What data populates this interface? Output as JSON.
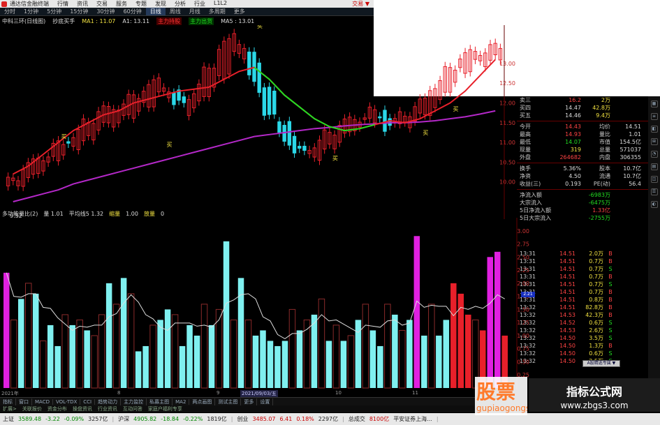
{
  "titlebar": {
    "app_title": "通达信金融终端",
    "menu": [
      "行情",
      "资讯",
      "交易",
      "服务",
      "专题",
      "发现",
      "分析",
      "行业",
      "L1L2"
    ],
    "login": "交易 ▼"
  },
  "periods": [
    "分时",
    "1分钟",
    "5分钟",
    "15分钟",
    "30分钟",
    "60分钟",
    "日线",
    "周线",
    "月线",
    "多周期",
    "更多"
  ],
  "period_selected": "日线",
  "infoline": {
    "name": "中科三环(日线图)",
    "indicator": "抄底买手",
    "ma5": "MA1 : 11.07",
    "a1": "A1: 13.11",
    "sig_red": "主力持股",
    "sig_green": "主力出货",
    "ma_last": "MA5 : 13.01"
  },
  "kline_axis": {
    "labels": [
      "13.00",
      "12.50",
      "12.00",
      "11.50",
      "11.00",
      "10.50",
      "10.00"
    ],
    "low_label": "9.32",
    "buy_label": "买"
  },
  "volinfo": {
    "title": "多功能量比(2)",
    "v1": "量 1.01",
    "v2": "平均线5 1.32",
    "v3": "缩量",
    "v4": "1.00",
    "v5": "放量",
    "v6": "0"
  },
  "vol_axis": {
    "labels": [
      "3.00",
      "2.75",
      "2.50",
      "2.25",
      "2.00",
      "1.75",
      "1.50",
      "1.25",
      "1.00",
      "0.75",
      "0.50",
      "0.25"
    ],
    "current": "2.21"
  },
  "dates": [
    "2021年",
    "8",
    "9",
    "2021/09/03/五",
    "10",
    "11"
  ],
  "tabs": [
    "指标",
    "窗口",
    "MACD",
    "VOL-TDX",
    "CCI",
    "趋势动力",
    "主力监控",
    "私募主图",
    "MA2",
    "两点画图",
    "测试主图",
    "更多",
    "设置"
  ],
  "subtabs": [
    "扩展>",
    "关联报价",
    "资金分布",
    "操盘资讯",
    "行业资讯",
    "互动问答",
    "家庭户福利专享"
  ],
  "indexbar": [
    {
      "name": "上证",
      "val": "3589.48",
      "chg": "-3.22",
      "pct": "-0.09%",
      "amt": "3257亿"
    },
    {
      "name": "沪深",
      "val": "4905.82",
      "chg": "-18.84",
      "pct": "-0.22%",
      "amt": "1819亿"
    },
    {
      "name": "创业",
      "val": "3485.07",
      "chg": "6.41",
      "pct": "0.18%",
      "amt": "2297亿"
    },
    {
      "name": "总成交",
      "val": "8100亿",
      "chg": "",
      "pct": "",
      "amt": "平安证券上海..."
    }
  ],
  "quote": {
    "rows": [
      {
        "k": "卖三",
        "p": "16.2",
        "v": "2万",
        "pc": "red"
      },
      {
        "k": "买四",
        "p": "14.47",
        "v": "42.8万",
        "pc": "wht"
      },
      {
        "k": "买五",
        "p": "14.46",
        "v": "9.4万",
        "pc": "wht"
      },
      {
        "k": "今开",
        "p": "14.43",
        "v": "均价",
        "v2": "14.51",
        "pc": "red"
      },
      {
        "k": "最高",
        "p": "14.93",
        "v": "量比",
        "v2": "1.01",
        "pc": "red"
      },
      {
        "k": "最低",
        "p": "14.07",
        "v": "市值",
        "v2": "154.5亿",
        "pc": "grn"
      },
      {
        "k": "现量",
        "p": "319",
        "v": "总量",
        "v2": "571037",
        "pc": "yel"
      },
      {
        "k": "外盘",
        "p": "264682",
        "v": "内盘",
        "v2": "306355",
        "pc": "red"
      },
      {
        "k": "换手",
        "p": "5.36%",
        "v": "股本",
        "v2": "10.7亿",
        "pc": "wht"
      },
      {
        "k": "净资",
        "p": "4.50",
        "v": "流通",
        "v2": "10.7亿",
        "pc": "wht"
      },
      {
        "k": "收益(三)",
        "p": "0.193",
        "v": "PE(动)",
        "v2": "56.4",
        "pc": "wht"
      }
    ],
    "flows": [
      {
        "k": "净流入额",
        "v": "-6983万",
        "pc": "grn"
      },
      {
        "k": "大宗流入",
        "v": "-6475万",
        "pc": "grn"
      },
      {
        "k": "5日净流入额",
        "v": "1.33亿",
        "pc": "red"
      },
      {
        "k": "5日大宗流入",
        "v": "-2755万",
        "pc": "grn"
      }
    ]
  },
  "ticks": [
    {
      "t": "13:31",
      "p": "14.51",
      "v": "2.0万",
      "bs": "B"
    },
    {
      "t": "13:31",
      "p": "14.51",
      "v": "0.7万",
      "bs": "B"
    },
    {
      "t": "13:31",
      "p": "14.51",
      "v": "0.7万",
      "bs": "S"
    },
    {
      "t": "13:31",
      "p": "14.51",
      "v": "0.7万",
      "bs": "B"
    },
    {
      "t": "13:31",
      "p": "14.51",
      "v": "0.7万",
      "bs": "S"
    },
    {
      "t": "13:31",
      "p": "14.51",
      "v": "0.7万",
      "bs": "B"
    },
    {
      "t": "13:31",
      "p": "14.51",
      "v": "0.8万",
      "bs": "B"
    },
    {
      "t": "13:32",
      "p": "14.51",
      "v": "82.8万",
      "bs": "B"
    },
    {
      "t": "13:32",
      "p": "14.53",
      "v": "42.3万",
      "bs": "B"
    },
    {
      "t": "13:32",
      "p": "14.52",
      "v": "0.6万",
      "bs": "S"
    },
    {
      "t": "13:32",
      "p": "14.53",
      "v": "2.6万",
      "bs": "S"
    },
    {
      "t": "13:32",
      "p": "14.50",
      "v": "3.5万",
      "bs": "S"
    },
    {
      "t": "13:32",
      "p": "14.50",
      "v": "1.3万",
      "bs": "B"
    },
    {
      "t": "13:32",
      "p": "14.50",
      "v": "0.6万",
      "bs": "S"
    },
    {
      "t": "13:32",
      "p": "14.50",
      "v": "2.5万",
      "bs": "S"
    }
  ],
  "popup": "A股精选专属 ▼",
  "watermark": {
    "big": "股票",
    "small": "gupiaogongshi",
    "site_title": "指标公式网",
    "site_url": "www.zbgs3.com"
  },
  "colors": {
    "up": "#e8202a",
    "down": "#2bd8e8",
    "ma_red": "#e8202a",
    "ma_green": "#22dd22",
    "ma_purple": "#b428c8",
    "vol_cyan": "#7ff0f0",
    "vol_brown": "#5a1212",
    "vol_magenta": "#e020e0"
  },
  "chart_data": {
    "type": "line",
    "kline": {
      "ma_red": [
        10.2,
        10.4,
        10.7,
        11.0,
        11.3,
        11.5,
        11.7,
        11.8,
        12.0,
        12.1,
        12.2,
        12.3,
        12.35,
        12.4,
        12.6,
        12.8,
        12.9,
        12.6,
        12.2,
        11.9,
        11.6,
        11.4,
        11.3,
        11.35,
        11.45,
        11.55,
        11.5,
        11.6,
        11.8,
        12.0,
        12.3,
        12.7,
        13.1
      ],
      "ma_purple": [
        9.5,
        9.6,
        9.7,
        9.8,
        9.95,
        10.05,
        10.15,
        10.25,
        10.35,
        10.45,
        10.55,
        10.65,
        10.75,
        10.85,
        10.95,
        11.05,
        11.15,
        11.2,
        11.25,
        11.3,
        11.35,
        11.38,
        11.42,
        11.45,
        11.47,
        11.5,
        11.5,
        11.52,
        11.55,
        11.6,
        11.65,
        11.72,
        11.8
      ],
      "candles": [
        [
          9.9,
          10.0
        ],
        [
          10.0,
          10.4
        ],
        [
          10.3,
          10.6
        ],
        [
          10.6,
          10.9
        ],
        [
          10.9,
          11.1
        ],
        [
          11.0,
          11.5
        ],
        [
          11.4,
          11.8
        ],
        [
          11.5,
          11.9
        ],
        [
          11.7,
          12.1
        ],
        [
          11.9,
          12.4
        ],
        [
          12.2,
          12.6
        ],
        [
          12.3,
          11.9
        ],
        [
          11.8,
          12.2
        ],
        [
          12.2,
          12.8
        ],
        [
          12.6,
          13.4
        ],
        [
          13.2,
          13.8
        ],
        [
          13.3,
          12.6
        ],
        [
          12.5,
          11.8
        ],
        [
          11.6,
          11.2
        ],
        [
          11.1,
          10.7
        ],
        [
          10.6,
          10.9
        ],
        [
          10.8,
          11.2
        ],
        [
          11.1,
          11.5
        ],
        [
          11.4,
          11.6
        ],
        [
          11.6,
          11.8
        ],
        [
          11.7,
          11.4
        ],
        [
          11.4,
          11.7
        ],
        [
          11.6,
          11.9
        ],
        [
          11.8,
          12.4
        ],
        [
          12.3,
          12.8
        ],
        [
          12.8,
          13.2
        ],
        [
          13.0,
          13.3
        ],
        [
          13.1,
          13.4
        ]
      ]
    },
    "volume": {
      "ylim": [
        0,
        3.25
      ],
      "bars": [
        2.2,
        1.3,
        1.7,
        2.0,
        1.8,
        0.9,
        1.2,
        0.8,
        1.4,
        1.2,
        1.3,
        1.1,
        1.0,
        1.4,
        2.0,
        1.6,
        2.1,
        1.8,
        0.7,
        0.8,
        1.2,
        1.3,
        1.5,
        1.4,
        0.8,
        1.2,
        1.0,
        1.6,
        1.2,
        1.5,
        2.8,
        1.3,
        2.1,
        1.3,
        1.0,
        1.1,
        0.9,
        0.8,
        0.9,
        1.5,
        1.1,
        1.3,
        1.4,
        1.7,
        0.9,
        1.2,
        0.9,
        1.0,
        1.3,
        1.6,
        1.1,
        0.8,
        1.6,
        1.4,
        1.1,
        1.3,
        2.9,
        1.0,
        1.6,
        1.0,
        1.3,
        2.0,
        1.8,
        1.4,
        1.3,
        1.1,
        2.5,
        2.6,
        1.0
      ],
      "kinds": [
        "m",
        "b",
        "c",
        "b",
        "c",
        "b",
        "c",
        "c",
        "b",
        "c",
        "b",
        "c",
        "b",
        "b",
        "c",
        "b",
        "c",
        "b",
        "c",
        "c",
        "b",
        "c",
        "c",
        "b",
        "c",
        "c",
        "c",
        "b",
        "c",
        "b",
        "c",
        "b",
        "c",
        "b",
        "c",
        "c",
        "c",
        "c",
        "c",
        "b",
        "c",
        "b",
        "c",
        "b",
        "c",
        "b",
        "c",
        "b",
        "c",
        "b",
        "c",
        "c",
        "b",
        "c",
        "b",
        "c",
        "m",
        "c",
        "b",
        "c",
        "c",
        "r",
        "r",
        "r",
        "b",
        "r",
        "m",
        "m",
        "r"
      ]
    }
  }
}
